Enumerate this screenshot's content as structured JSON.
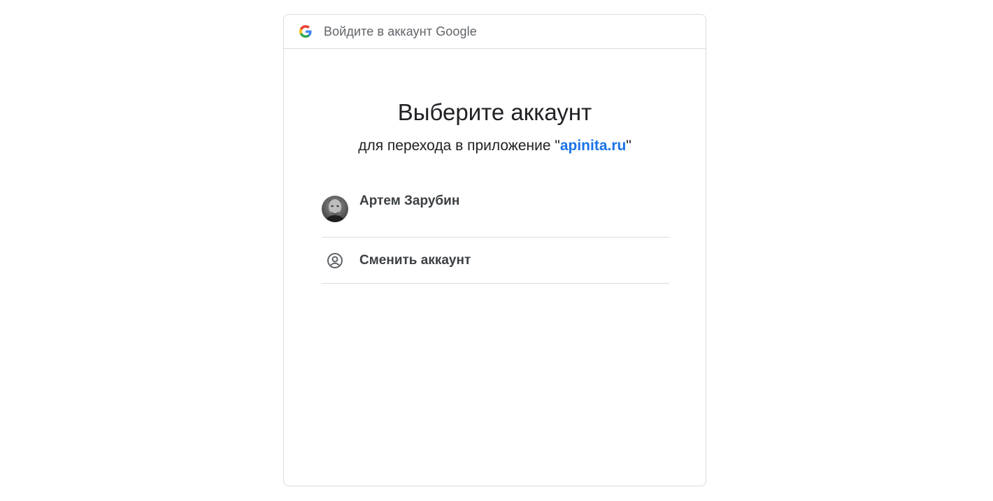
{
  "header": {
    "title": "Войдите в аккаунт Google",
    "logo_icon": "google-g-icon"
  },
  "main": {
    "title": "Выберите аккаунт",
    "subtitle_prefix": "для перехода в приложение \"",
    "app_name": "apinita.ru",
    "subtitle_suffix": "\""
  },
  "accounts": [
    {
      "name": "Артем Зарубин",
      "avatar_icon": "user-photo-avatar"
    }
  ],
  "switch_account": {
    "label": "Сменить аккаунт",
    "icon": "account-circle-icon"
  },
  "colors": {
    "link": "#1a73e8",
    "text_primary": "#202124",
    "text_secondary": "#5f6368",
    "divider": "#dadce0"
  }
}
